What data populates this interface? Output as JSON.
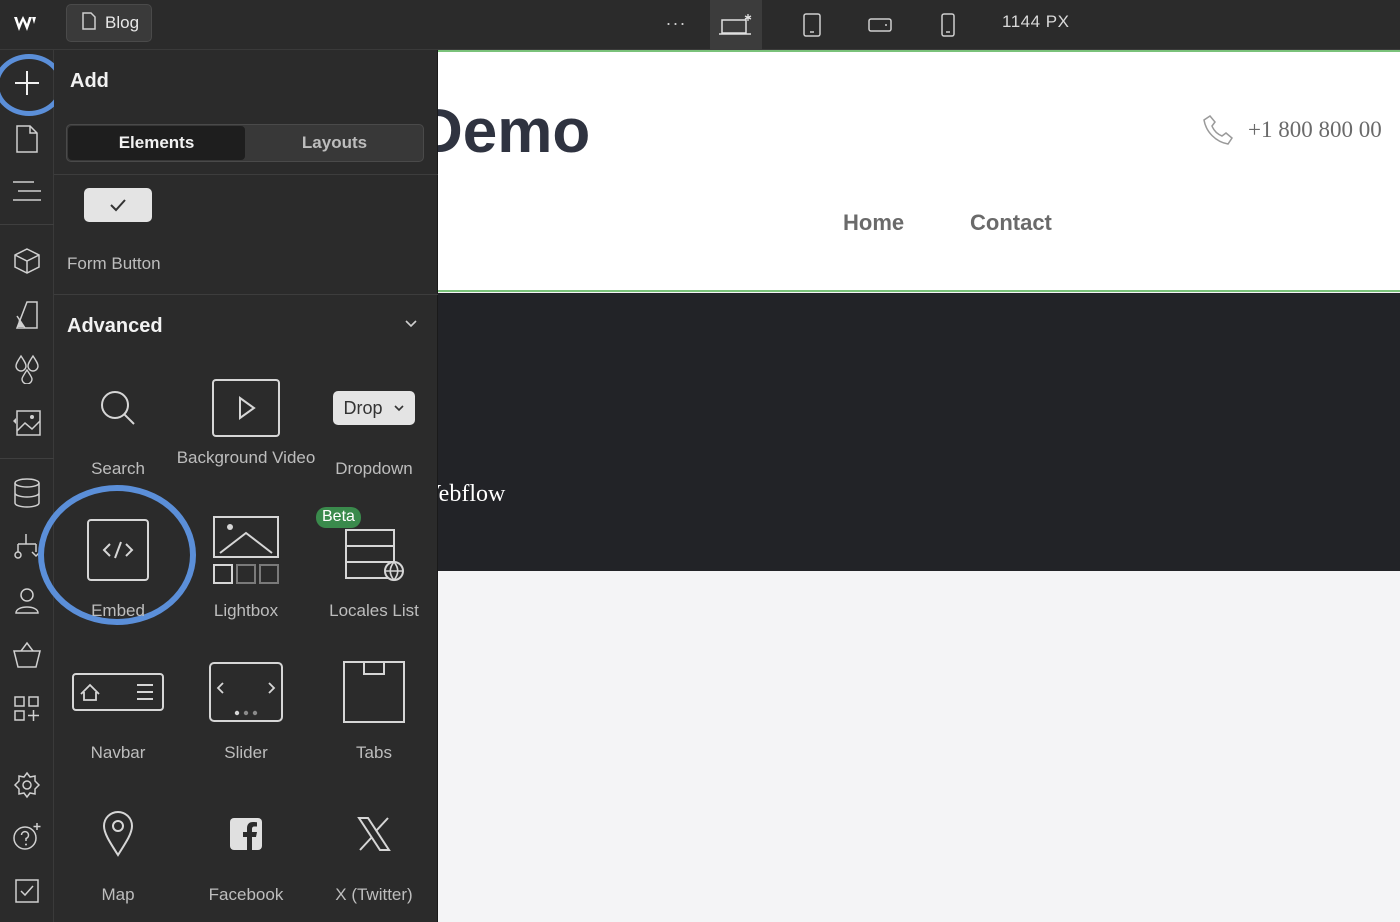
{
  "topbar": {
    "page_name": "Blog",
    "more_label": "···",
    "width_readout": "1144 PX",
    "breakpoints": [
      "desktop-base",
      "tablet",
      "mobile-landscape",
      "mobile-portrait"
    ]
  },
  "panel": {
    "title": "Add",
    "tabs": [
      {
        "label": "Elements",
        "active": true
      },
      {
        "label": "Layouts",
        "active": false
      }
    ],
    "form_button_label": "Form Button",
    "section_title": "Advanced",
    "badge": "Beta",
    "dropdown_chip": "Drop",
    "items": [
      {
        "label": "Search",
        "icon": "search-icon"
      },
      {
        "label": "Background Video",
        "icon": "play-icon"
      },
      {
        "label": "Dropdown",
        "icon": "dropdown-icon"
      },
      {
        "label": "Embed",
        "icon": "code-icon"
      },
      {
        "label": "Lightbox",
        "icon": "image-icon"
      },
      {
        "label": "Locales List",
        "icon": "locales-icon"
      },
      {
        "label": "Navbar",
        "icon": "navbar-icon"
      },
      {
        "label": "Slider",
        "icon": "slider-icon"
      },
      {
        "label": "Tabs",
        "icon": "tabs-icon"
      },
      {
        "label": "Map",
        "icon": "map-pin-icon"
      },
      {
        "label": "Facebook",
        "icon": "facebook-icon"
      },
      {
        "label": "X (Twitter)",
        "icon": "x-twitter-icon"
      }
    ]
  },
  "canvas": {
    "brand_text": "Demo",
    "phone": "+1 800 800 00",
    "nav": [
      "Home",
      "Contact"
    ],
    "hero_text": "Vebflow"
  },
  "colors": {
    "highlight_ring": "#5b8fd9",
    "beta_badge": "#3a8a4c",
    "panel_bg": "#2b2b2b",
    "hero_bg": "#222327"
  }
}
